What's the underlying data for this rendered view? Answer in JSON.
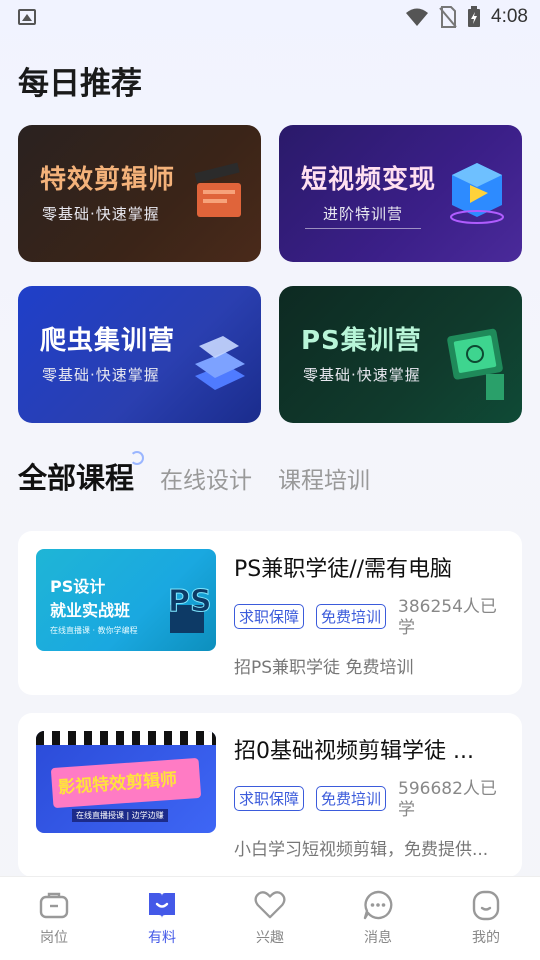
{
  "status_bar": {
    "time": "4:08"
  },
  "daily": {
    "title": "每日推荐",
    "banners": [
      {
        "title": "特效剪辑师",
        "subtitle": "零基础·快速掌握"
      },
      {
        "title": "短视频变现",
        "subtitle": "进阶特训营"
      },
      {
        "title": "爬虫集训营",
        "subtitle": "零基础·快速掌握"
      },
      {
        "title": "PS集训营",
        "subtitle": "零基础·快速掌握"
      }
    ]
  },
  "tabs": {
    "active": "全部课程",
    "others": [
      "在线设计",
      "课程培训"
    ]
  },
  "courses": [
    {
      "thumb_line1": "PS设计",
      "thumb_line2": "就业实战班",
      "thumb_line3": "在线直播课 · 教你学编程",
      "title": "PS兼职学徒//需有电脑",
      "tags": [
        "求职保障",
        "免费培训"
      ],
      "count": "386254人已学",
      "desc": "招PS兼职学徒 免费培训"
    },
    {
      "thumb_line1": "影视特效剪辑师",
      "thumb_line2": "在线直播授课 | 边学边赚",
      "title": "招0基础视频剪辑学徒 ...",
      "tags": [
        "求职保障",
        "免费培训"
      ],
      "count": "596682人已学",
      "desc": "小白学习短视频剪辑，免费提供..."
    }
  ],
  "nav": [
    {
      "label": "岗位",
      "icon": "briefcase-icon"
    },
    {
      "label": "有料",
      "icon": "book-icon"
    },
    {
      "label": "兴趣",
      "icon": "heart-icon"
    },
    {
      "label": "消息",
      "icon": "chat-icon"
    },
    {
      "label": "我的",
      "icon": "profile-icon"
    }
  ],
  "colors": {
    "accent": "#4459e8",
    "tag": "#3b5bdb"
  }
}
